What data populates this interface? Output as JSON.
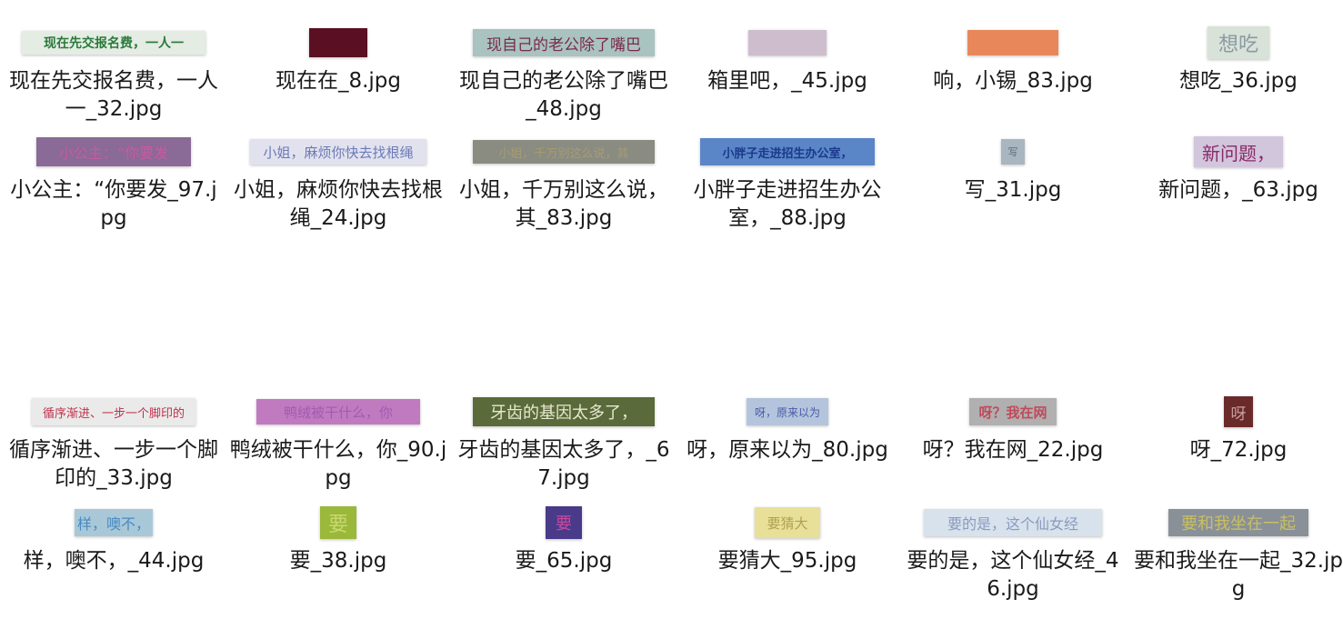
{
  "files": [
    {
      "name": "现在先交报名费，一人一_32.jpg",
      "thumb_text": "现在先交报名费，一人一",
      "thumb_bg": "#e4ece4",
      "thumb_fg": "#2a7a3a"
    },
    {
      "name": "现在在_8.jpg",
      "thumb_text": "",
      "thumb_bg": "#5a0f22",
      "thumb_fg": "#5a0f22"
    },
    {
      "name": "现自己的老公除了嘴巴_48.jpg",
      "thumb_text": "现自己的老公除了嘴巴",
      "thumb_bg": "#a8c3c0",
      "thumb_fg": "#7a2a4a"
    },
    {
      "name": "箱里吧，_45.jpg",
      "thumb_text": "",
      "thumb_bg": "#cdbdcd",
      "thumb_fg": "#b06a8a"
    },
    {
      "name": "响，小锡_83.jpg",
      "thumb_text": "",
      "thumb_bg": "#e8885a",
      "thumb_fg": "#ffffff"
    },
    {
      "name": "想吃_36.jpg",
      "thumb_text": "想吃",
      "thumb_bg": "#d8e2d8",
      "thumb_fg": "#8a9aa2"
    },
    {
      "name": "小公主：“你要发_97.jpg",
      "thumb_text": "小公主：“你要发",
      "thumb_bg": "#8a6a96",
      "thumb_fg": "#c85aa0"
    },
    {
      "name": "小姐，麻烦你快去找根绳_24.jpg",
      "thumb_text": "小姐，麻烦你快去找根绳",
      "thumb_bg": "#e2e2ee",
      "thumb_fg": "#6a7ab8"
    },
    {
      "name": "小姐，千万别这么说，其_83.jpg",
      "thumb_text": "小姐，千万别这么说，其",
      "thumb_bg": "#8a8c82",
      "thumb_fg": "#a89c70"
    },
    {
      "name": "小胖子走进招生办公室，_88.jpg",
      "thumb_text": "小胖子走进招生办公室，",
      "thumb_bg": "#5a86c8",
      "thumb_fg": "#1a3a8a"
    },
    {
      "name": "写_31.jpg",
      "thumb_text": "写",
      "thumb_bg": "#a8b6c0",
      "thumb_fg": "#5a6a78"
    },
    {
      "name": "新问题，_63.jpg",
      "thumb_text": "新问题，",
      "thumb_bg": "#d2c6dc",
      "thumb_fg": "#8a2a6a"
    },
    {
      "name": "循序渐进、一步一个脚印的_33.jpg",
      "thumb_text": "循序渐进、一步一个脚印的",
      "thumb_bg": "#eaeaea",
      "thumb_fg": "#c0304a"
    },
    {
      "name": "鸭绒被干什么，你_90.jpg",
      "thumb_text": "鸭绒被干什么，你",
      "thumb_bg": "#c07ac0",
      "thumb_fg": "#a25ab0"
    },
    {
      "name": "牙齿的基因太多了，_67.jpg",
      "thumb_text": "牙齿的基因太多了，",
      "thumb_bg": "#5a6a3a",
      "thumb_fg": "#e8e8d0"
    },
    {
      "name": "呀，原来以为_80.jpg",
      "thumb_text": "呀，原来以为",
      "thumb_bg": "#b4c4dc",
      "thumb_fg": "#4a5aa8"
    },
    {
      "name": "呀？我在网_22.jpg",
      "thumb_text": "呀？我在网",
      "thumb_bg": "#b0b0b0",
      "thumb_fg": "#c04a5a"
    },
    {
      "name": "呀_72.jpg",
      "thumb_text": "呀",
      "thumb_bg": "#6a2a2a",
      "thumb_fg": "#c8a0a0"
    },
    {
      "name": "样，噢不，_44.jpg",
      "thumb_text": "样，噢不，",
      "thumb_bg": "#a8c8d8",
      "thumb_fg": "#4a8ac0"
    },
    {
      "name": "要_38.jpg",
      "thumb_text": "要",
      "thumb_bg": "#9ab83a",
      "thumb_fg": "#c8d870"
    },
    {
      "name": "要_65.jpg",
      "thumb_text": "要",
      "thumb_bg": "#4a3a8a",
      "thumb_fg": "#c84aa0"
    },
    {
      "name": "要猜大_95.jpg",
      "thumb_text": "要猜大",
      "thumb_bg": "#e8e098",
      "thumb_fg": "#b0a050"
    },
    {
      "name": "要的是，这个仙女经_46.jpg",
      "thumb_text": "要的是，这个仙女经",
      "thumb_bg": "#d8e2ec",
      "thumb_fg": "#8a9ac0"
    },
    {
      "name": "要和我坐在一起_32.jpg",
      "thumb_text": "要和我坐在一起",
      "thumb_bg": "#8a9098",
      "thumb_fg": "#c8c060"
    }
  ]
}
